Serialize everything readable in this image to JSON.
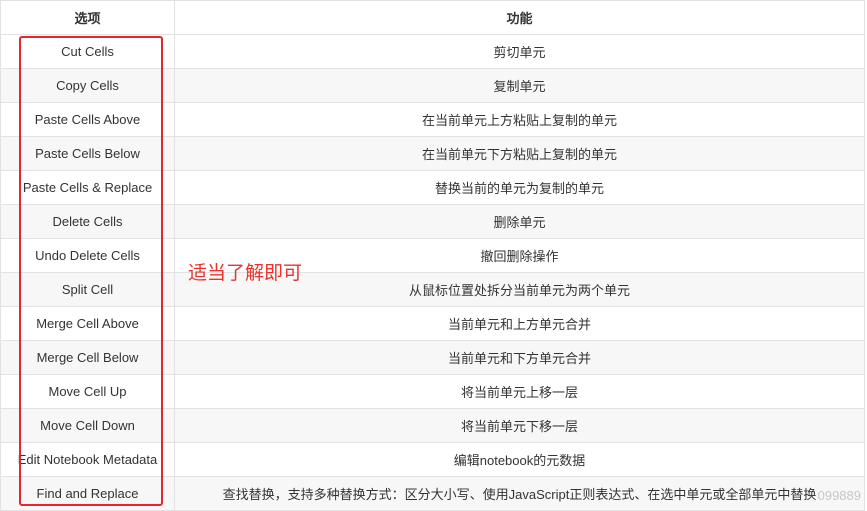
{
  "table": {
    "headers": [
      "选项",
      "功能"
    ],
    "rows": [
      {
        "option": "Cut Cells",
        "function": "剪切单元"
      },
      {
        "option": "Copy Cells",
        "function": "复制单元"
      },
      {
        "option": "Paste Cells Above",
        "function": "在当前单元上方粘贴上复制的单元"
      },
      {
        "option": "Paste Cells Below",
        "function": "在当前单元下方粘贴上复制的单元"
      },
      {
        "option": "Paste Cells & Replace",
        "function": "替换当前的单元为复制的单元"
      },
      {
        "option": "Delete Cells",
        "function": "删除单元"
      },
      {
        "option": "Undo Delete Cells",
        "function": "撤回删除操作"
      },
      {
        "option": "Split Cell",
        "function": "从鼠标位置处拆分当前单元为两个单元"
      },
      {
        "option": "Merge Cell Above",
        "function": "当前单元和上方单元合并"
      },
      {
        "option": "Merge Cell Below",
        "function": "当前单元和下方单元合并"
      },
      {
        "option": "Move Cell Up",
        "function": "将当前单元上移一层"
      },
      {
        "option": "Move Cell Down",
        "function": "将当前单元下移一层"
      },
      {
        "option": "Edit Notebook Metadata",
        "function": "编辑notebook的元数据"
      },
      {
        "option": "Find and Replace",
        "function": "查找替换，支持多种替换方式：区分大小写、使用JavaScript正则表达式、在选中单元或全部单元中替换"
      }
    ]
  },
  "annotation": {
    "note": "适当了解即可",
    "color": "#e5262a"
  },
  "watermark": "099889"
}
